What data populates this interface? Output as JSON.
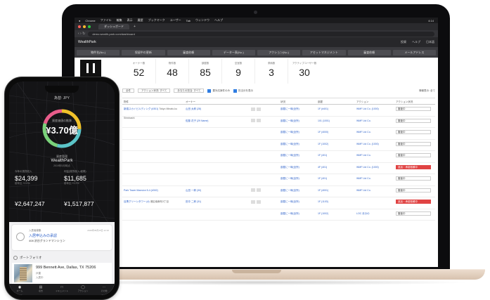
{
  "mac_menu": {
    "apple": "",
    "app": "Chrome",
    "items": [
      "ファイル",
      "編集",
      "表示",
      "履歴",
      "ブックマーク",
      "ユーザー",
      "Tab",
      "ウィンドウ",
      "ヘルプ"
    ],
    "clock": "4:14"
  },
  "browser": {
    "tab_title": "ダッシュボード",
    "url": "demo.wealth-park.com/dashboard"
  },
  "app": {
    "brand": "WealthPark",
    "header_right": [
      "投資",
      "ヘルプ",
      "日本語"
    ],
    "buttons": [
      "物件名(No.)",
      "保留中の更新",
      "審査依頼",
      "データー表(No.)",
      "アクション(No.)",
      "アセットマネジメント",
      "審査依頼",
      "メールアドレス"
    ],
    "stats": [
      {
        "label": "オーナー数",
        "value": "52"
      },
      {
        "label": "物件数",
        "value": "48"
      },
      {
        "label": "部屋数",
        "value": "85"
      },
      {
        "label": "空室数",
        "value": "9"
      },
      {
        "label": "滞納数",
        "value": "3"
      },
      {
        "label": "アクティブユーザー数",
        "value": "30"
      }
    ],
    "filters": {
      "f1": "全件",
      "f2": "アクション状況: すべて",
      "f3": "あなたの担当: すべて",
      "c1": "要対応案件のみ",
      "c2": "担当分を表示",
      "right": "情報表示: 全て"
    },
    "table": {
      "headers": [
        "物件",
        "オーナー",
        "",
        "状況",
        "部屋",
        "アクション",
        "アクション状況"
      ],
      "rows": [
        {
          "c1": "新橋スカイビルディング (#301)",
          "c1b": "Tokyo Minato-ku Shinbashi",
          "c2": "山田 太郎 (28)",
          "c3": "",
          "c4": "部屋に一時(全所)",
          "c5": "1F (#401)",
          "c6": "WMF Ltd Co. (1000)",
          "c7": "審査中",
          "red": false
        },
        {
          "c1": "",
          "c1b": "",
          "c2": "佐藤 花子 (29 Name)",
          "c3": "",
          "c4": "部屋に一時(全所)",
          "c5": "101 (1001)",
          "c6": "WMF Ltd Co.",
          "c7": "審査中",
          "red": false
        },
        {
          "c1": "",
          "c1b": "",
          "c2": "",
          "c3": "",
          "c4": "部屋に一時(全所)",
          "c5": "1F (4000)",
          "c6": "WMF Ltd Co.",
          "c7": "審査中",
          "red": false
        },
        {
          "c1": "",
          "c1b": "",
          "c2": "",
          "c3": "",
          "c4": "部屋に一時(全所)",
          "c5": "1F (1002)",
          "c6": "WMF Ltd Co. (1000)",
          "c7": "審査中",
          "red": false
        },
        {
          "c1": "",
          "c1b": "",
          "c2": "",
          "c3": "",
          "c4": "部屋に一時(全所)",
          "c5": "1F (401)",
          "c6": "WMF Ltd Co.",
          "c7": "審査中",
          "red": false
        },
        {
          "c1": "",
          "c1b": "",
          "c2": "",
          "c3": "",
          "c4": "部屋に一時(全所)",
          "c5": "4F (401)",
          "c6": "WMF Ltd Co. (1000)",
          "c7": "追加・承認依頼中",
          "red": true
        },
        {
          "c1": "",
          "c1b": "",
          "c2": "",
          "c3": "",
          "c4": "部屋に一時(全所)",
          "c5": "1F (401)",
          "c6": "WMF Ltd Co.",
          "c7": "審査中",
          "red": false
        },
        {
          "c1": "Park Tower Mansion 5-4 (#302)",
          "c1b": "",
          "c2": "山田 一郎 (30)",
          "c3": "",
          "c4": "部屋に一時(全所)",
          "c5": "1F (4001)",
          "c6": "WMF Ltd Co.",
          "c7": "審査中",
          "red": false
        },
        {
          "c1": "目黒グリーンタワー (#)",
          "c1b": "港区南麻布3丁目",
          "c2": "田中 二郎 (31)",
          "c3": "",
          "c4": "部屋に一時(全所)",
          "c5": "1F (1103)",
          "c6": "",
          "c7": "追加・承認依頼中",
          "red": true
        },
        {
          "c1": "",
          "c1b": "",
          "c2": "",
          "c3": "",
          "c4": "部屋に一時(全所)",
          "c5": "1F (1002)",
          "c6": "LOC 月分の",
          "c7": "審査中",
          "red": false
        }
      ]
    }
  },
  "phone": {
    "header": "為替: JPY",
    "ring_label": "資産価値の推移",
    "ring_value": "¥3.70億",
    "name_label": "資産管理",
    "name": "WealthPark",
    "name_sub": "2019年5月時点",
    "left": {
      "label": "今年の賃貸収入",
      "value": "$24,399",
      "sub": "前年比 +2.0%"
    },
    "right": {
      "label": "利益(賃貸収入-経費)",
      "value": "$11,685",
      "sub": "前年比 +1.2%"
    },
    "big_left": "¥2,647,247",
    "big_right": "¥1,517,877",
    "card": {
      "t1": "入居者募集",
      "t2": "入居申込みの承認",
      "t3": "408 渋谷グランドマンション",
      "t4": "2019年05月15日 12:10"
    },
    "portfolio": "ポートフォリオ",
    "property": {
      "address": "999 Bennett Ave, Dallas, TX 75206",
      "s1": "戸建",
      "s2": "入居中"
    },
    "tabs": [
      "ホーム",
      "収支",
      "ドキュメント",
      "アクション",
      "その他"
    ]
  },
  "colors": {
    "accent": "#2f62c9",
    "danger": "#e04343",
    "ring": [
      "#f0c12a",
      "#5bc4c8",
      "#7ad27a",
      "#e85c8a"
    ]
  }
}
